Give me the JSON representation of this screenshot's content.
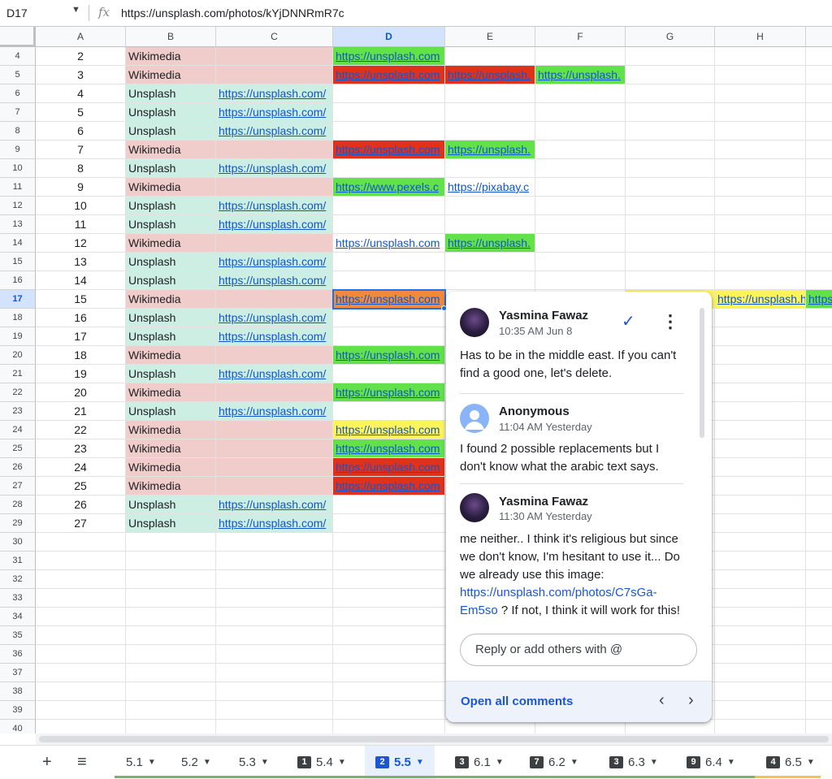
{
  "formula_bar": {
    "cell_ref": "D17",
    "fx": "fx",
    "value": "https://unsplash.com/photos/kYjDNNRmR7c",
    "caret": "▼"
  },
  "columns": [
    "A",
    "B",
    "C",
    "D",
    "E",
    "F",
    "G",
    "H"
  ],
  "selected_column": "D",
  "rows": [
    {
      "num": "4",
      "a": "2",
      "b": "Wikimedia",
      "c": "",
      "d": "https://unsplash.com",
      "e": "",
      "f": ""
    },
    {
      "num": "5",
      "a": "3",
      "b": "Wikimedia",
      "c": "",
      "d": "https://unsplash.com",
      "e": "https://unsplash.",
      "f": "https://unsplash."
    },
    {
      "num": "6",
      "a": "4",
      "b": "Unsplash",
      "c": "https://unsplash.com/",
      "d": "",
      "e": "",
      "f": ""
    },
    {
      "num": "7",
      "a": "5",
      "b": "Unsplash",
      "c": "https://unsplash.com/",
      "d": "",
      "e": "",
      "f": ""
    },
    {
      "num": "8",
      "a": "6",
      "b": "Unsplash",
      "c": "https://unsplash.com/",
      "d": "",
      "e": "",
      "f": ""
    },
    {
      "num": "9",
      "a": "7",
      "b": "Wikimedia",
      "c": "",
      "d": "https://unsplash.com",
      "e": "https://unsplash.",
      "f": ""
    },
    {
      "num": "10",
      "a": "8",
      "b": "Unsplash",
      "c": "https://unsplash.com/",
      "d": "",
      "e": "",
      "f": ""
    },
    {
      "num": "11",
      "a": "9",
      "b": "Wikimedia",
      "c": "",
      "d": "https://www.pexels.c",
      "e": "https://pixabay.c",
      "f": ""
    },
    {
      "num": "12",
      "a": "10",
      "b": "Unsplash",
      "c": "https://unsplash.com/",
      "d": "",
      "e": "",
      "f": ""
    },
    {
      "num": "13",
      "a": "11",
      "b": "Unsplash",
      "c": "https://unsplash.com/",
      "d": "",
      "e": "",
      "f": ""
    },
    {
      "num": "14",
      "a": "12",
      "b": "Wikimedia",
      "c": "",
      "d": "https://unsplash.com",
      "e": "https://unsplash.",
      "f": ""
    },
    {
      "num": "15",
      "a": "13",
      "b": "Unsplash",
      "c": "https://unsplash.com/",
      "d": "",
      "e": "",
      "f": ""
    },
    {
      "num": "16",
      "a": "14",
      "b": "Unsplash",
      "c": "https://unsplash.com/",
      "d": "",
      "e": "",
      "f": ""
    },
    {
      "num": "17",
      "a": "15",
      "b": "Wikimedia",
      "c": "",
      "d": "https://unsplash.com",
      "e": "",
      "f": "",
      "g_tail": ".",
      "h": "https://unsplash.",
      "i": "https"
    },
    {
      "num": "18",
      "a": "16",
      "b": "Unsplash",
      "c": "https://unsplash.com/",
      "d": "",
      "e": "",
      "f": ""
    },
    {
      "num": "19",
      "a": "17",
      "b": "Unsplash",
      "c": "https://unsplash.com/",
      "d": "",
      "e": "",
      "f": ""
    },
    {
      "num": "20",
      "a": "18",
      "b": "Wikimedia",
      "c": "",
      "d": "https://unsplash.com",
      "e": "",
      "f": ""
    },
    {
      "num": "21",
      "a": "19",
      "b": "Unsplash",
      "c": "https://unsplash.com/",
      "d": "",
      "e": "",
      "f": ""
    },
    {
      "num": "22",
      "a": "20",
      "b": "Wikimedia",
      "c": "",
      "d": "https://unsplash.com",
      "e": "",
      "f": ""
    },
    {
      "num": "23",
      "a": "21",
      "b": "Unsplash",
      "c": "https://unsplash.com/",
      "d": "",
      "e": "",
      "f": ""
    },
    {
      "num": "24",
      "a": "22",
      "b": "Wikimedia",
      "c": "",
      "d": "https://unsplash.com",
      "e": "",
      "f": ""
    },
    {
      "num": "25",
      "a": "23",
      "b": "Wikimedia",
      "c": "",
      "d": "https://unsplash.com",
      "e": "",
      "f": ""
    },
    {
      "num": "26",
      "a": "24",
      "b": "Wikimedia",
      "c": "",
      "d": "https://unsplash.com",
      "e": "",
      "f": ""
    },
    {
      "num": "27",
      "a": "25",
      "b": "Wikimedia",
      "c": "",
      "d": "https://unsplash.com",
      "e": "",
      "f": ""
    },
    {
      "num": "28",
      "a": "26",
      "b": "Unsplash",
      "c": "https://unsplash.com/",
      "d": "",
      "e": "",
      "f": ""
    },
    {
      "num": "29",
      "a": "27",
      "b": "Unsplash",
      "c": "https://unsplash.com/",
      "d": "",
      "e": "",
      "f": ""
    },
    {
      "num": "30"
    },
    {
      "num": "31"
    },
    {
      "num": "32"
    },
    {
      "num": "33"
    },
    {
      "num": "34"
    },
    {
      "num": "35"
    },
    {
      "num": "36"
    },
    {
      "num": "37"
    },
    {
      "num": "38"
    },
    {
      "num": "39"
    },
    {
      "num": "40"
    }
  ],
  "cell_colors": {
    "wikimedia": "#f0cccb",
    "unsplash": "#cdeee3",
    "green": "#62e14b",
    "red": "#e0311c",
    "yellow": "#fdf45a",
    "orange": "#ee8a3b"
  },
  "comment_thread": {
    "comments": [
      {
        "author": "Yasmina Fawaz",
        "time": "10:35 AM Jun 8",
        "text": "Has to be in the middle east. If you can't find a good one, let's delete."
      },
      {
        "author": "Anonymous",
        "time": "11:04 AM Yesterday",
        "text": "I found 2 possible replacements but I don't know what the arabic text says."
      },
      {
        "author": "Yasmina Fawaz",
        "time": "11:30 AM Yesterday",
        "text_before": "me neither.. I think it's religious but since we don't know, I'm hesitant to use it... Do we already use this image: ",
        "link": "https://unsplash.com/photos/C7sGa-Em5so",
        "text_after": " ? If not, I think it will work for this!"
      }
    ],
    "reply_placeholder": "Reply or add others with @",
    "open_all_label": "Open all comments",
    "resolve_icon": "✓",
    "more_icon": "⋮",
    "prev_icon": "‹",
    "next_icon": "›"
  },
  "sheet_tabs": [
    {
      "label": "5.1",
      "badge": ""
    },
    {
      "label": "5.2",
      "badge": ""
    },
    {
      "label": "5.3",
      "badge": ""
    },
    {
      "label": "5.4",
      "badge": "1"
    },
    {
      "label": "5.5",
      "badge": "2",
      "active": true
    },
    {
      "label": "6.1",
      "badge": "3"
    },
    {
      "label": "6.2",
      "badge": "7"
    },
    {
      "label": "6.3",
      "badge": "3"
    },
    {
      "label": "6.4",
      "badge": "9"
    },
    {
      "label": "6.5",
      "badge": "4"
    }
  ],
  "tab_controls": {
    "add": "+",
    "all_sheets": "≡",
    "caret": "▼"
  }
}
